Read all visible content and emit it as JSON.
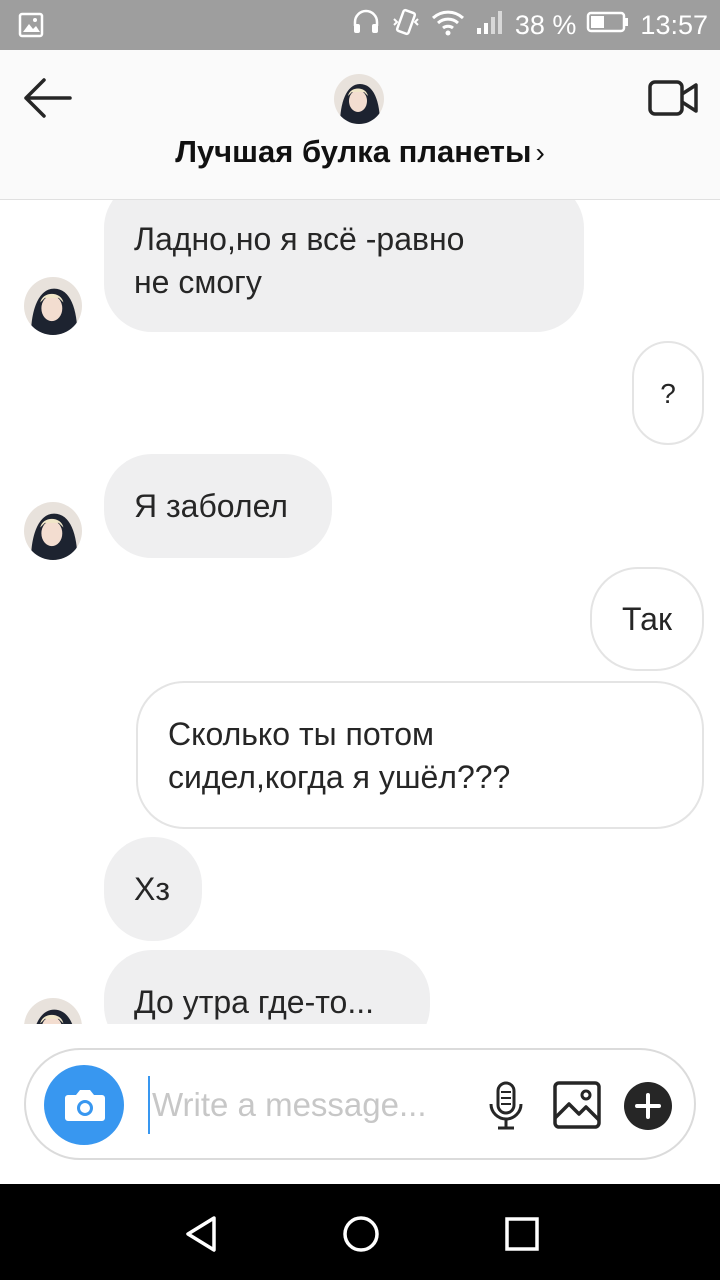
{
  "status_bar": {
    "battery_percent": "38 %",
    "time": "13:57",
    "icons": [
      "image-icon",
      "headphones-icon",
      "vibrate-icon",
      "wifi-icon",
      "signal-icon",
      "battery-icon"
    ]
  },
  "header": {
    "title": "Лучшая булка планеты",
    "chevron": "›",
    "icons": [
      "back-arrow-icon",
      "avatar",
      "video-call-icon"
    ]
  },
  "messages": [
    {
      "side": "in",
      "text_lines": [
        "Ладно,но я всё -равно",
        "не смогу"
      ]
    },
    {
      "side": "out",
      "text_lines": [
        "?"
      ]
    },
    {
      "side": "in",
      "text_lines": [
        "Я заболел"
      ]
    },
    {
      "side": "out",
      "text_lines": [
        "Так"
      ]
    },
    {
      "side": "out",
      "text_lines": [
        "Сколько ты потом",
        "сидел,когда я ушёл???"
      ]
    },
    {
      "side": "in",
      "text_lines": [
        "Хз"
      ]
    },
    {
      "side": "in",
      "text_lines": [
        "До утра где-то..."
      ]
    }
  ],
  "composer": {
    "placeholder": "Write a message...",
    "value": "",
    "icons": [
      "camera-icon",
      "microphone-icon",
      "gallery-icon",
      "plus-icon"
    ]
  },
  "nav_bar": {
    "icons": [
      "back-triangle-icon",
      "home-circle-icon",
      "recents-square-icon"
    ]
  },
  "colors": {
    "accent": "#3897f0",
    "incoming_bubble": "#efeff0",
    "outgoing_border": "#e4e4e4",
    "status_bar": "#9e9e9e"
  }
}
